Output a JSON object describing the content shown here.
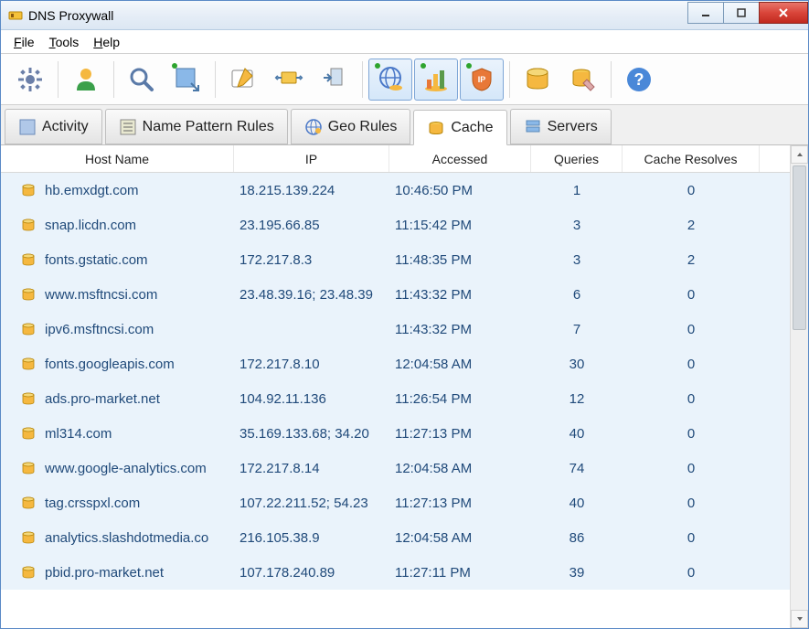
{
  "window": {
    "title": "DNS Proxywall"
  },
  "menu": {
    "file": "File",
    "tools": "Tools",
    "help": "Help"
  },
  "tabs": {
    "activity": "Activity",
    "rules": "Name Pattern Rules",
    "geo": "Geo Rules",
    "cache": "Cache",
    "servers": "Servers"
  },
  "table": {
    "headers": {
      "host": "Host Name",
      "ip": "IP",
      "accessed": "Accessed",
      "queries": "Queries",
      "cache_resolves": "Cache Resolves"
    },
    "rows": [
      {
        "host": "hb.emxdgt.com",
        "ip": "18.215.139.224",
        "accessed": "10:46:50 PM",
        "queries": "1",
        "cr": "0"
      },
      {
        "host": "snap.licdn.com",
        "ip": "23.195.66.85",
        "accessed": "11:15:42 PM",
        "queries": "3",
        "cr": "2"
      },
      {
        "host": "fonts.gstatic.com",
        "ip": "172.217.8.3",
        "accessed": "11:48:35 PM",
        "queries": "3",
        "cr": "2"
      },
      {
        "host": "www.msftncsi.com",
        "ip": "23.48.39.16; 23.48.39",
        "accessed": "11:43:32 PM",
        "queries": "6",
        "cr": "0"
      },
      {
        "host": "ipv6.msftncsi.com",
        "ip": "",
        "accessed": "11:43:32 PM",
        "queries": "7",
        "cr": "0"
      },
      {
        "host": "fonts.googleapis.com",
        "ip": "172.217.8.10",
        "accessed": "12:04:58 AM",
        "queries": "30",
        "cr": "0"
      },
      {
        "host": "ads.pro-market.net",
        "ip": "104.92.11.136",
        "accessed": "11:26:54 PM",
        "queries": "12",
        "cr": "0"
      },
      {
        "host": "ml314.com",
        "ip": "35.169.133.68; 34.20",
        "accessed": "11:27:13 PM",
        "queries": "40",
        "cr": "0"
      },
      {
        "host": "www.google-analytics.com",
        "ip": "172.217.8.14",
        "accessed": "12:04:58 AM",
        "queries": "74",
        "cr": "0"
      },
      {
        "host": "tag.crsspxl.com",
        "ip": "107.22.211.52; 54.23",
        "accessed": "11:27:13 PM",
        "queries": "40",
        "cr": "0"
      },
      {
        "host": "analytics.slashdotmedia.co",
        "ip": "216.105.38.9",
        "accessed": "12:04:58 AM",
        "queries": "86",
        "cr": "0"
      },
      {
        "host": "pbid.pro-market.net",
        "ip": "107.178.240.89",
        "accessed": "11:27:11 PM",
        "queries": "39",
        "cr": "0"
      }
    ]
  }
}
